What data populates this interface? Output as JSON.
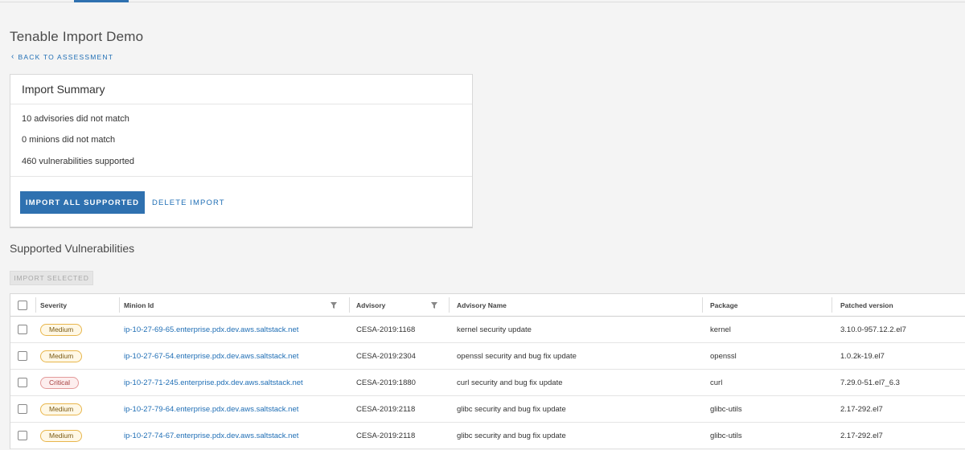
{
  "page": {
    "title": "Tenable Import Demo",
    "back_link": "BACK TO ASSESSMENT",
    "accent_color": "#2f71b0"
  },
  "summary": {
    "title": "Import Summary",
    "stats": [
      "10 advisories did not match",
      "0 minions did not match",
      "460 vulnerabilities supported"
    ],
    "import_all_label": "IMPORT ALL SUPPORTED",
    "delete_label": "DELETE IMPORT"
  },
  "vulnerabilities": {
    "title": "Supported Vulnerabilities",
    "import_selected_label": "IMPORT SELECTED",
    "columns": [
      "Severity",
      "Minion Id",
      "Advisory",
      "Advisory Name",
      "Package",
      "Patched version"
    ],
    "rows": [
      {
        "severity": "Medium",
        "minion": "ip-10-27-69-65.enterprise.pdx.dev.aws.saltstack.net",
        "advisory": "CESA-2019:1168",
        "name": "kernel security update",
        "package": "kernel",
        "patched": "3.10.0-957.12.2.el7"
      },
      {
        "severity": "Medium",
        "minion": "ip-10-27-67-54.enterprise.pdx.dev.aws.saltstack.net",
        "advisory": "CESA-2019:2304",
        "name": "openssl security and bug fix update",
        "package": "openssl",
        "patched": "1.0.2k-19.el7"
      },
      {
        "severity": "Critical",
        "minion": "ip-10-27-71-245.enterprise.pdx.dev.aws.saltstack.net",
        "advisory": "CESA-2019:1880",
        "name": "curl security and bug fix update",
        "package": "curl",
        "patched": "7.29.0-51.el7_6.3"
      },
      {
        "severity": "Medium",
        "minion": "ip-10-27-79-64.enterprise.pdx.dev.aws.saltstack.net",
        "advisory": "CESA-2019:2118",
        "name": "glibc security and bug fix update",
        "package": "glibc-utils",
        "patched": "2.17-292.el7"
      },
      {
        "severity": "Medium",
        "minion": "ip-10-27-74-67.enterprise.pdx.dev.aws.saltstack.net",
        "advisory": "CESA-2019:2118",
        "name": "glibc security and bug fix update",
        "package": "glibc-utils",
        "patched": "2.17-292.el7"
      }
    ]
  }
}
